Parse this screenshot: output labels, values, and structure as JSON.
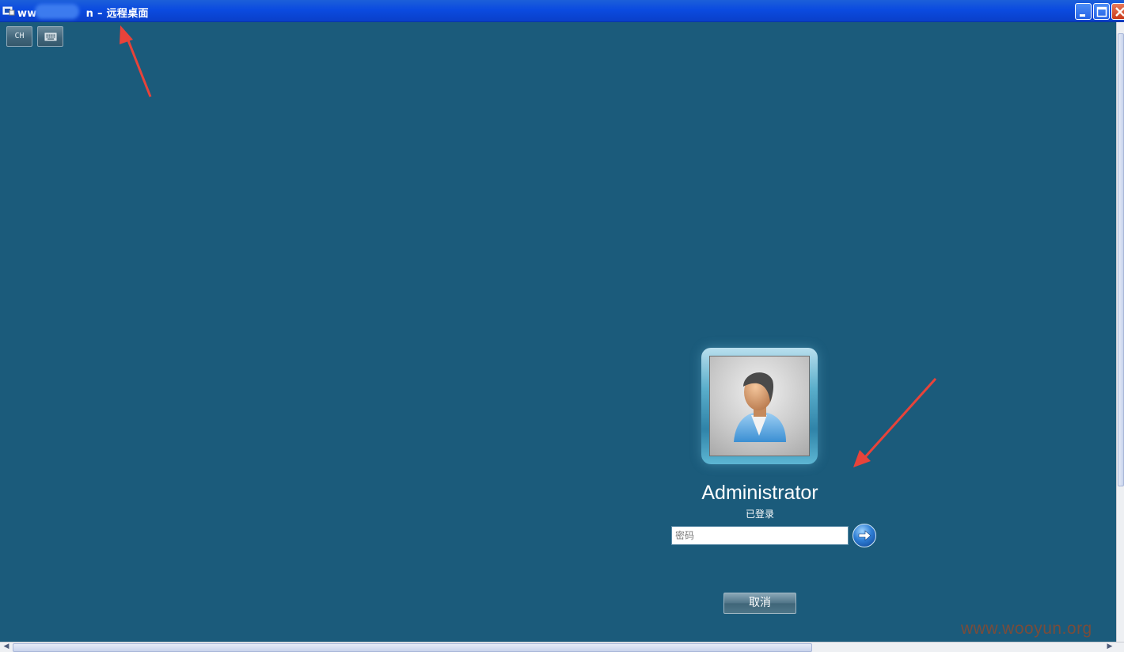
{
  "window": {
    "title_prefix": "ww",
    "title_suffix": "n – 远程桌面",
    "minimize_label": "_",
    "maximize_label": "□",
    "close_label": "✕"
  },
  "toolbar": {
    "language_label": "CH",
    "keyboard_icon": "keyboard-icon"
  },
  "login": {
    "username": "Administrator",
    "status": "已登录",
    "password_placeholder": "密码",
    "password_value": "",
    "submit_icon": "arrow-right-icon",
    "cancel_label": "取消"
  },
  "watermark": "www.wooyun.org",
  "colors": {
    "desktop_bg": "#1b5b7b",
    "titlebar": "#0b4be0",
    "annotation_arrow": "#e8433a"
  }
}
